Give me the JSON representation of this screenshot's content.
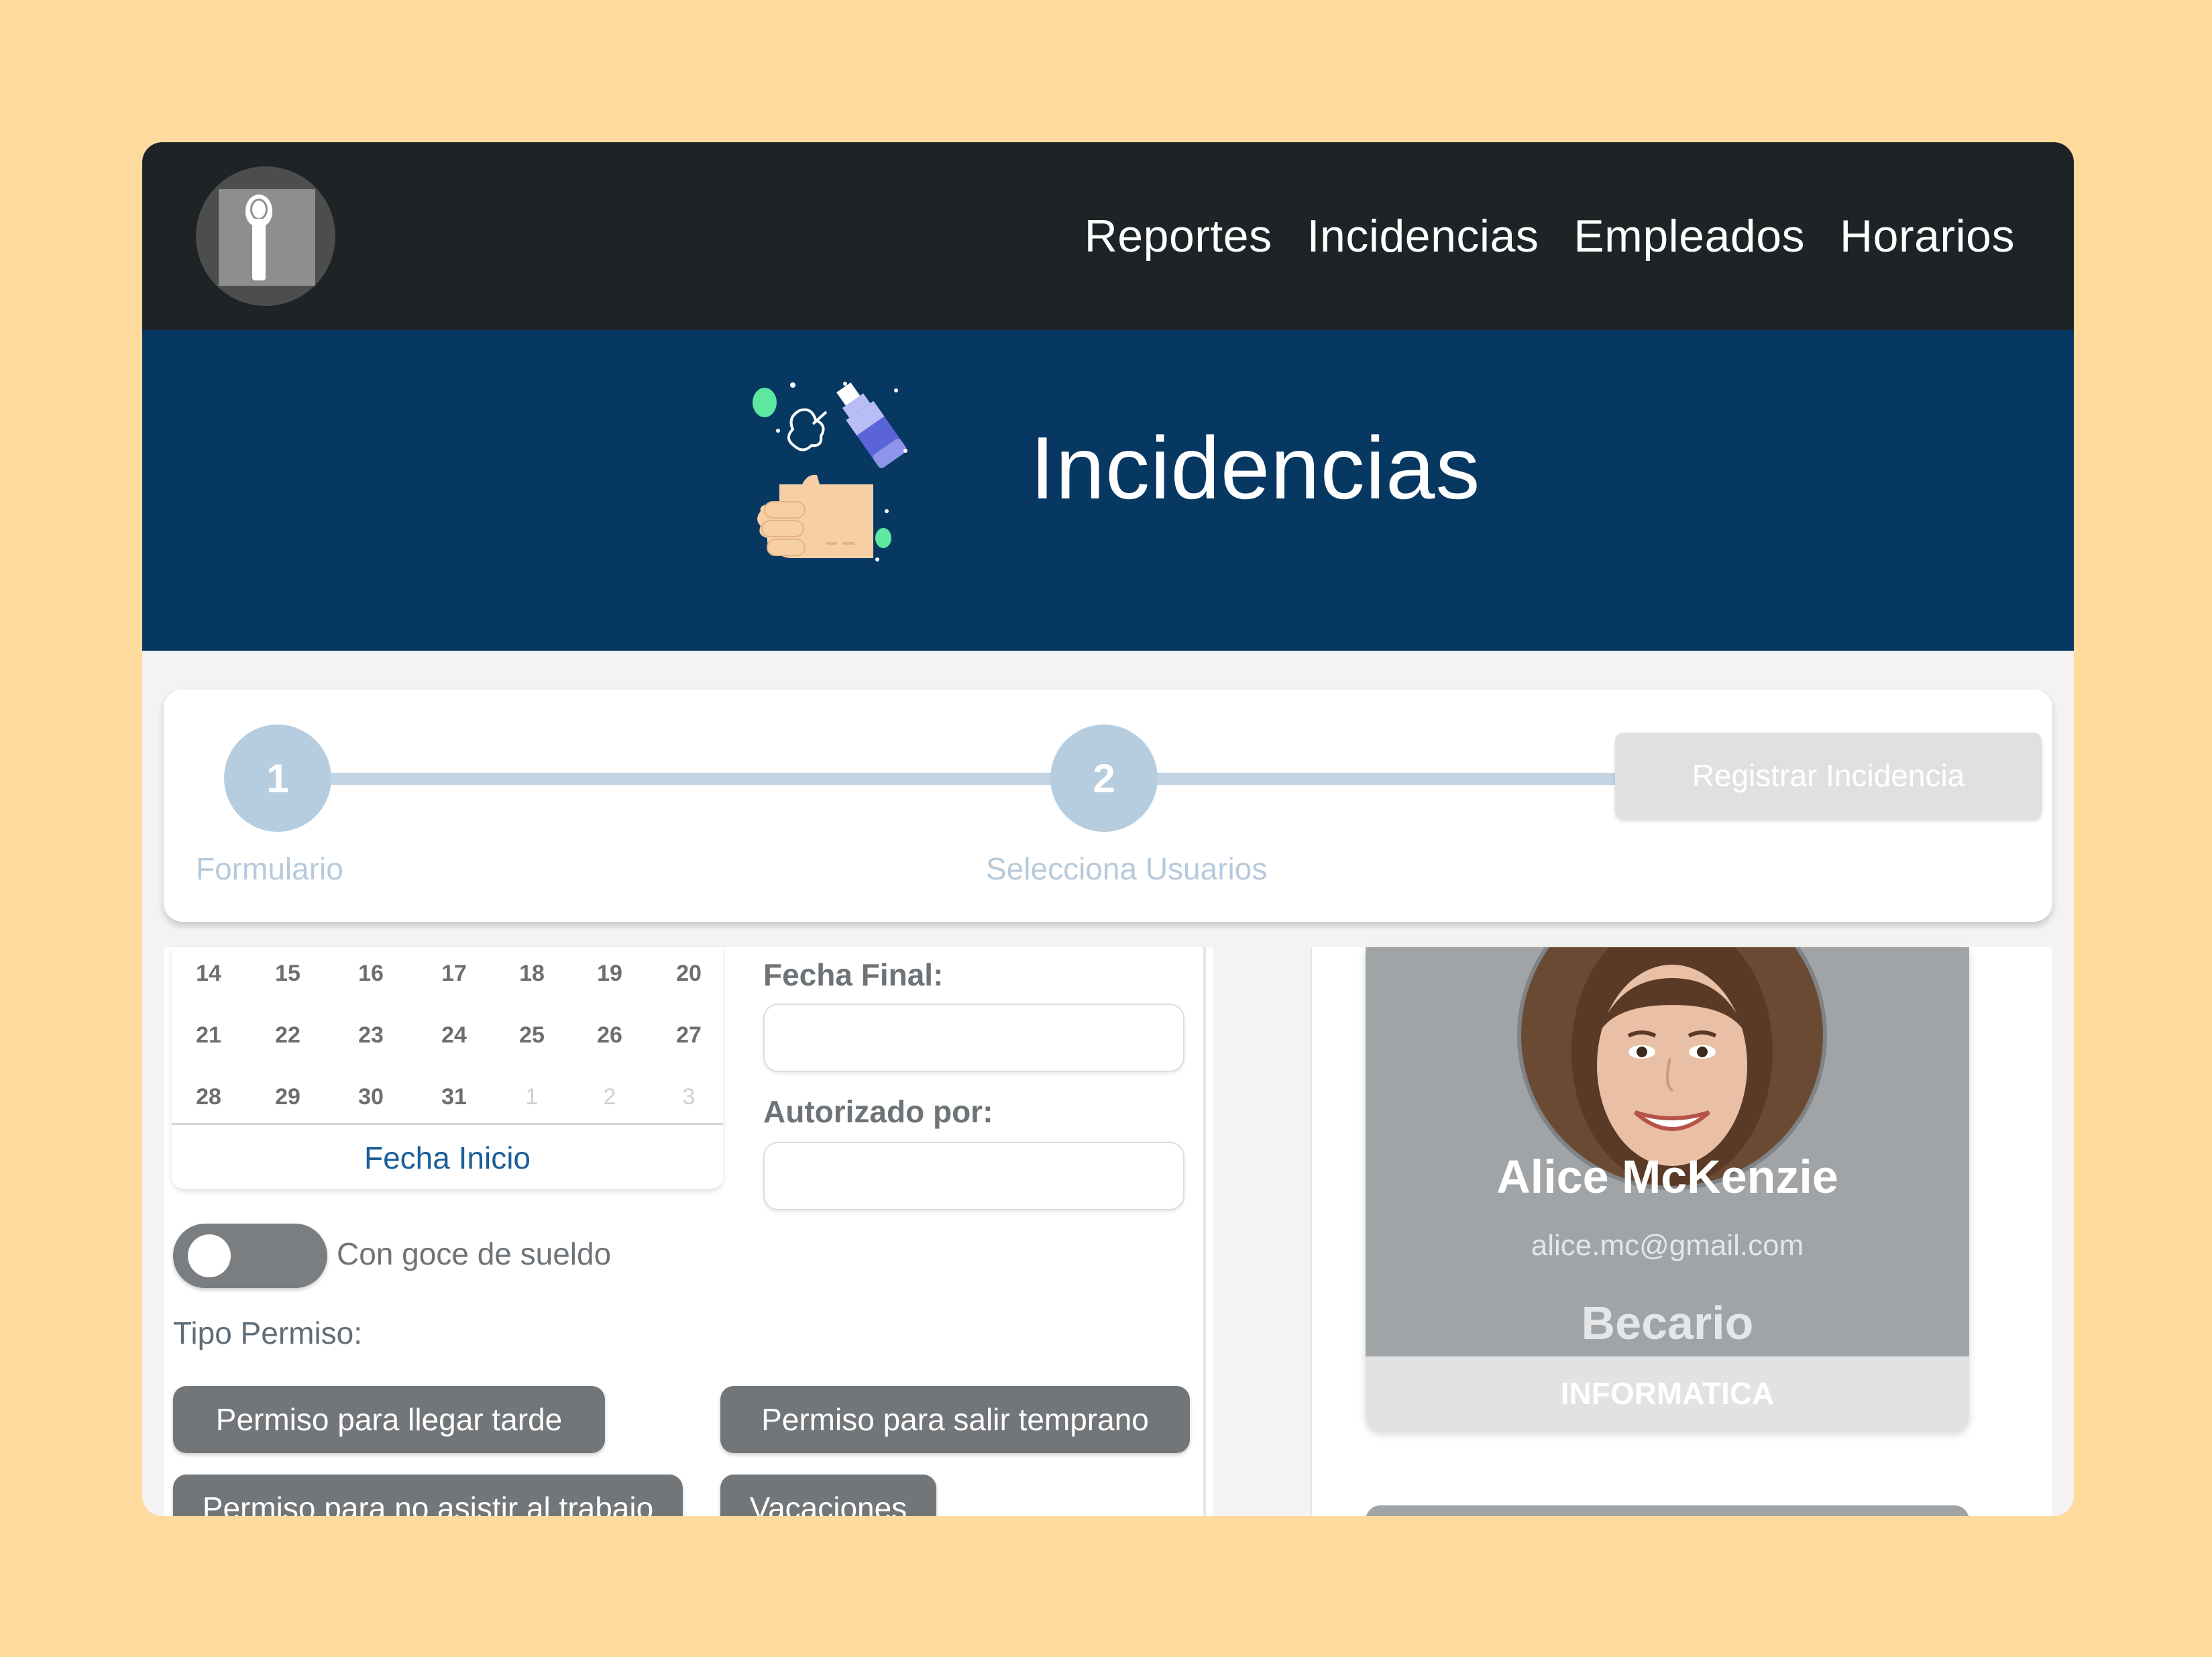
{
  "nav": {
    "logo": "fingerprint-logo",
    "items": [
      "Reportes",
      "Incidencias",
      "Empleados",
      "Horarios"
    ]
  },
  "hero": {
    "title": "Incidencias",
    "illustration": "hand-sanitizer-illustration"
  },
  "stepper": {
    "steps": [
      {
        "number": "1",
        "label": "Formulario"
      },
      {
        "number": "2",
        "label": "Selecciona Usuarios"
      }
    ],
    "register_label": "Registrar Incidencia"
  },
  "calendar": {
    "rows": [
      [
        "14",
        "15",
        "16",
        "17",
        "18",
        "19",
        "20"
      ],
      [
        "21",
        "22",
        "23",
        "24",
        "25",
        "26",
        "27"
      ],
      [
        "28",
        "29",
        "30",
        "31",
        "1",
        "2",
        "3"
      ]
    ],
    "label": "Fecha Inicio"
  },
  "form": {
    "fecha_final_label": "Fecha Final:",
    "fecha_final_value": "",
    "autorizado_label": "Autorizado por:",
    "autorizado_value": "",
    "toggle_label": "Con goce de sueldo",
    "toggle_on": false,
    "tipo_label": "Tipo Permiso:",
    "chips": [
      "Permiso para llegar tarde",
      "Permiso para salir temprano",
      "Permiso para no asistir al trabajo",
      "Vacaciones"
    ]
  },
  "profile": {
    "name": "Alice McKenzie",
    "email": "alice.mc@gmail.com",
    "role": "Becario",
    "department": "INFORMATICA"
  },
  "colors": {
    "page_bg": "#FFDA9D",
    "nav_bg": "#1E2326",
    "hero_bg": "#063862",
    "step_accent": "#B5CDDF",
    "chip_bg": "#737679"
  }
}
